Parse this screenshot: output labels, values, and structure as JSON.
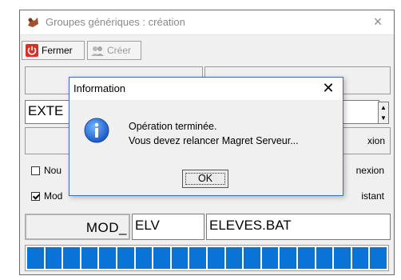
{
  "window": {
    "title": "Groupes génériques : création",
    "close": "×",
    "icon": "app-icon"
  },
  "toolbar": {
    "fermer_label": "Fermer",
    "creer_label": "Créer"
  },
  "form": {
    "text_field": "EXTE",
    "side_label_1": "xion",
    "checkbox_1_label": "Nou",
    "checkbox_1_checked": false,
    "checkbox_1_right": "nexion",
    "checkbox_2_label": "Mod",
    "checkbox_2_checked": true,
    "checkbox_2_right": "istant",
    "prefix": "MOD_",
    "group_field": "ELV",
    "file_field": "ELEVES.BAT"
  },
  "progress": {
    "segments": 20,
    "fraction": 1.0,
    "color": "#0a73d6"
  },
  "dialog": {
    "title": "Information",
    "close": "✕",
    "icon": "info-icon",
    "message_line_1": "Opération terminée.",
    "message_line_2": "Vous devez relancer Magret Serveur...",
    "ok_label": "OK"
  }
}
